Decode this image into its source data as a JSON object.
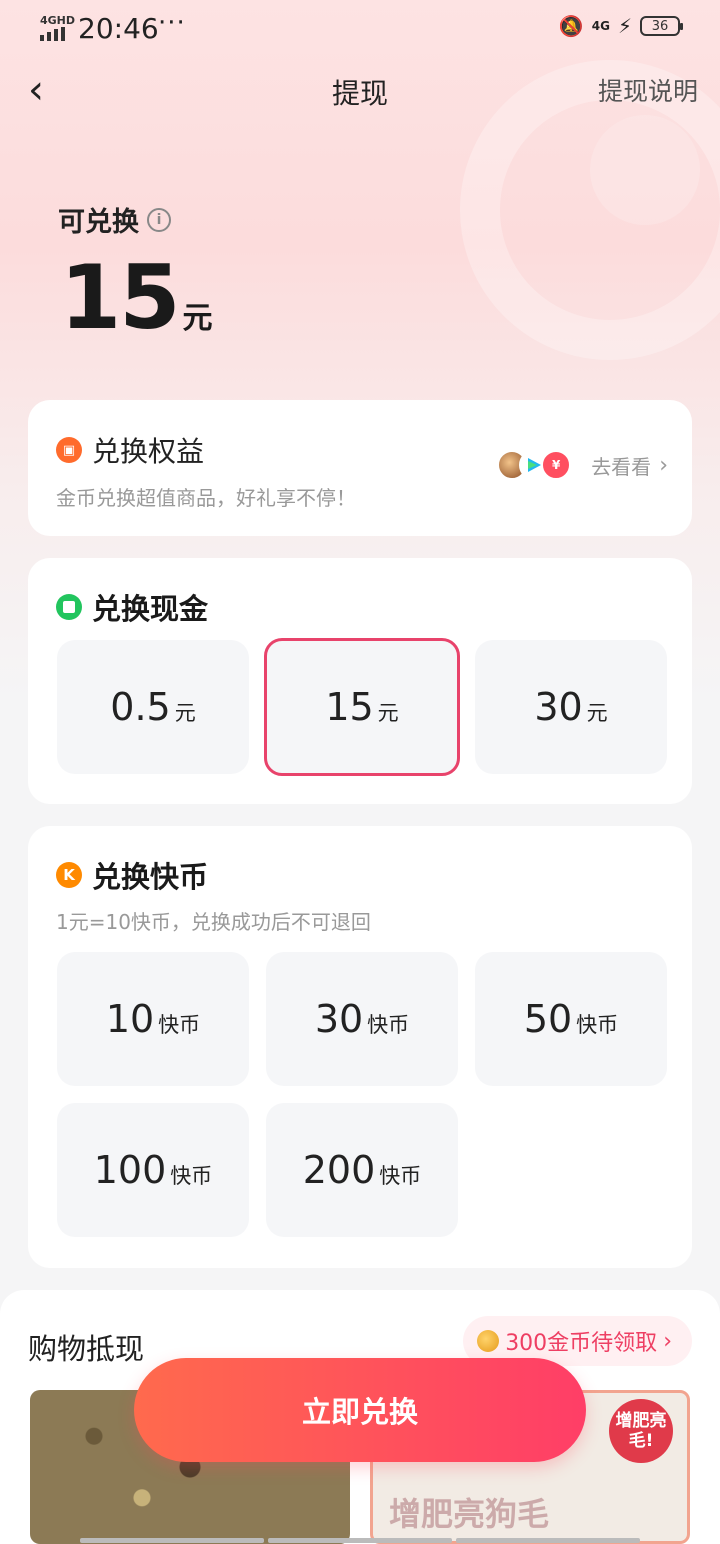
{
  "status_bar": {
    "network": "4GHD",
    "time": "20:46",
    "dots": "···",
    "net2": "4G",
    "battery": "36"
  },
  "nav": {
    "back": "‹",
    "title": "提现",
    "help_link": "提现说明"
  },
  "balance": {
    "label": "可兑换",
    "info": "i",
    "amount": "15",
    "unit": "元"
  },
  "benefit": {
    "title": "兑换权益",
    "subtitle": "金币兑换超值商品，好礼享不停！",
    "link": "去看看",
    "icon3": "¥"
  },
  "cash": {
    "title": "兑换现金",
    "options": [
      {
        "value": "0.5",
        "unit": "元"
      },
      {
        "value": "15",
        "unit": "元",
        "selected": true
      },
      {
        "value": "30",
        "unit": "元"
      }
    ]
  },
  "kcoin": {
    "title": "兑换快币",
    "icon": "K",
    "subtitle": "1元=10快币，兑换成功后不可退回",
    "options": [
      {
        "value": "10",
        "unit": "快币"
      },
      {
        "value": "30",
        "unit": "快币"
      },
      {
        "value": "50",
        "unit": "快币"
      },
      {
        "value": "100",
        "unit": "快币"
      },
      {
        "value": "200",
        "unit": "快币"
      }
    ]
  },
  "shopping": {
    "title": "购物抵现",
    "badge": "300金币待领取",
    "img2_text": "增肥亮狗毛",
    "tag": "增肥亮毛!"
  },
  "cta": {
    "label": "立即兑换"
  },
  "colors": {
    "accent": "#ff3e67",
    "selected_border": "#e8436b",
    "gift_orange": "#ff6b2c",
    "cash_green": "#22c55e",
    "k_orange": "#ff8a00"
  }
}
